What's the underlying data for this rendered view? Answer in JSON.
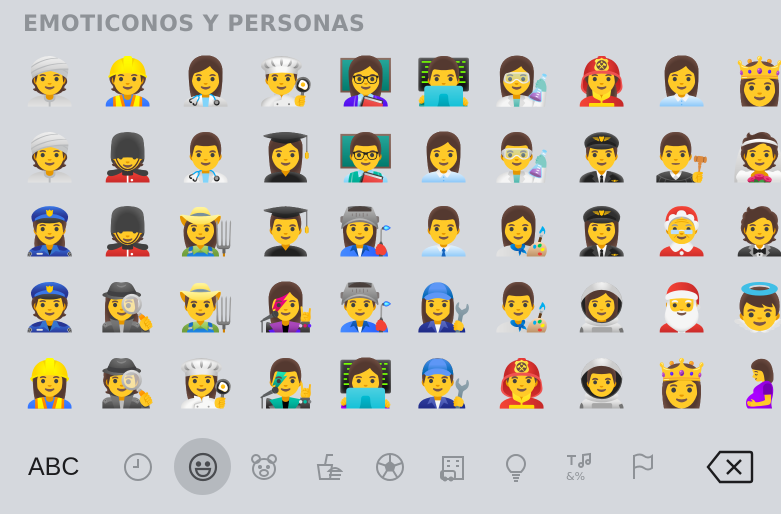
{
  "section_title": "EMOTICONOS Y PERSONAS",
  "emoji_rows": [
    [
      "👳",
      "👷",
      "👩‍⚕️",
      "👨‍🍳",
      "👩‍🏫",
      "👨‍💻",
      "👩‍🔬",
      "👩‍🚒",
      "👩‍💼",
      "👸"
    ],
    [
      "👳",
      "💂",
      "👨‍⚕️",
      "👩‍🎓",
      "👨‍🏫",
      "👩‍💼",
      "👨‍🔬",
      "👨‍✈️",
      "👨‍⚖️",
      "👰"
    ],
    [
      "👮‍♀️",
      "💂",
      "👩‍🌾",
      "👨‍🎓",
      "👩‍🏭",
      "👨‍💼",
      "👩‍🎨",
      "👩‍✈️",
      "🤶",
      "🤵"
    ],
    [
      "👮",
      "🕵️‍♀️",
      "👨‍🌾",
      "👩‍🎤",
      "👨‍🏭",
      "👩‍🔧",
      "👨‍🎨",
      "👩‍🚀",
      "🎅",
      "👼"
    ],
    [
      "👷‍♀️",
      "🕵️",
      "👩‍🍳",
      "👨‍🎤",
      "👩‍💻",
      "👨‍🔧",
      "👨‍🚒",
      "👨‍🚀",
      "👸",
      "🤰"
    ]
  ],
  "toolbar": {
    "abc_label": "ABC",
    "categories": [
      "clock-icon",
      "smiley-icon",
      "bear-icon",
      "food-icon",
      "ball-icon",
      "building-icon",
      "bulb-icon",
      "symbols-icon",
      "flag-icon"
    ],
    "active_category": "smiley-icon"
  },
  "colors": {
    "background": "#d5d8dd",
    "title": "#8e9297",
    "icon": "#8e9297",
    "active_bg": "#b5b9be"
  }
}
